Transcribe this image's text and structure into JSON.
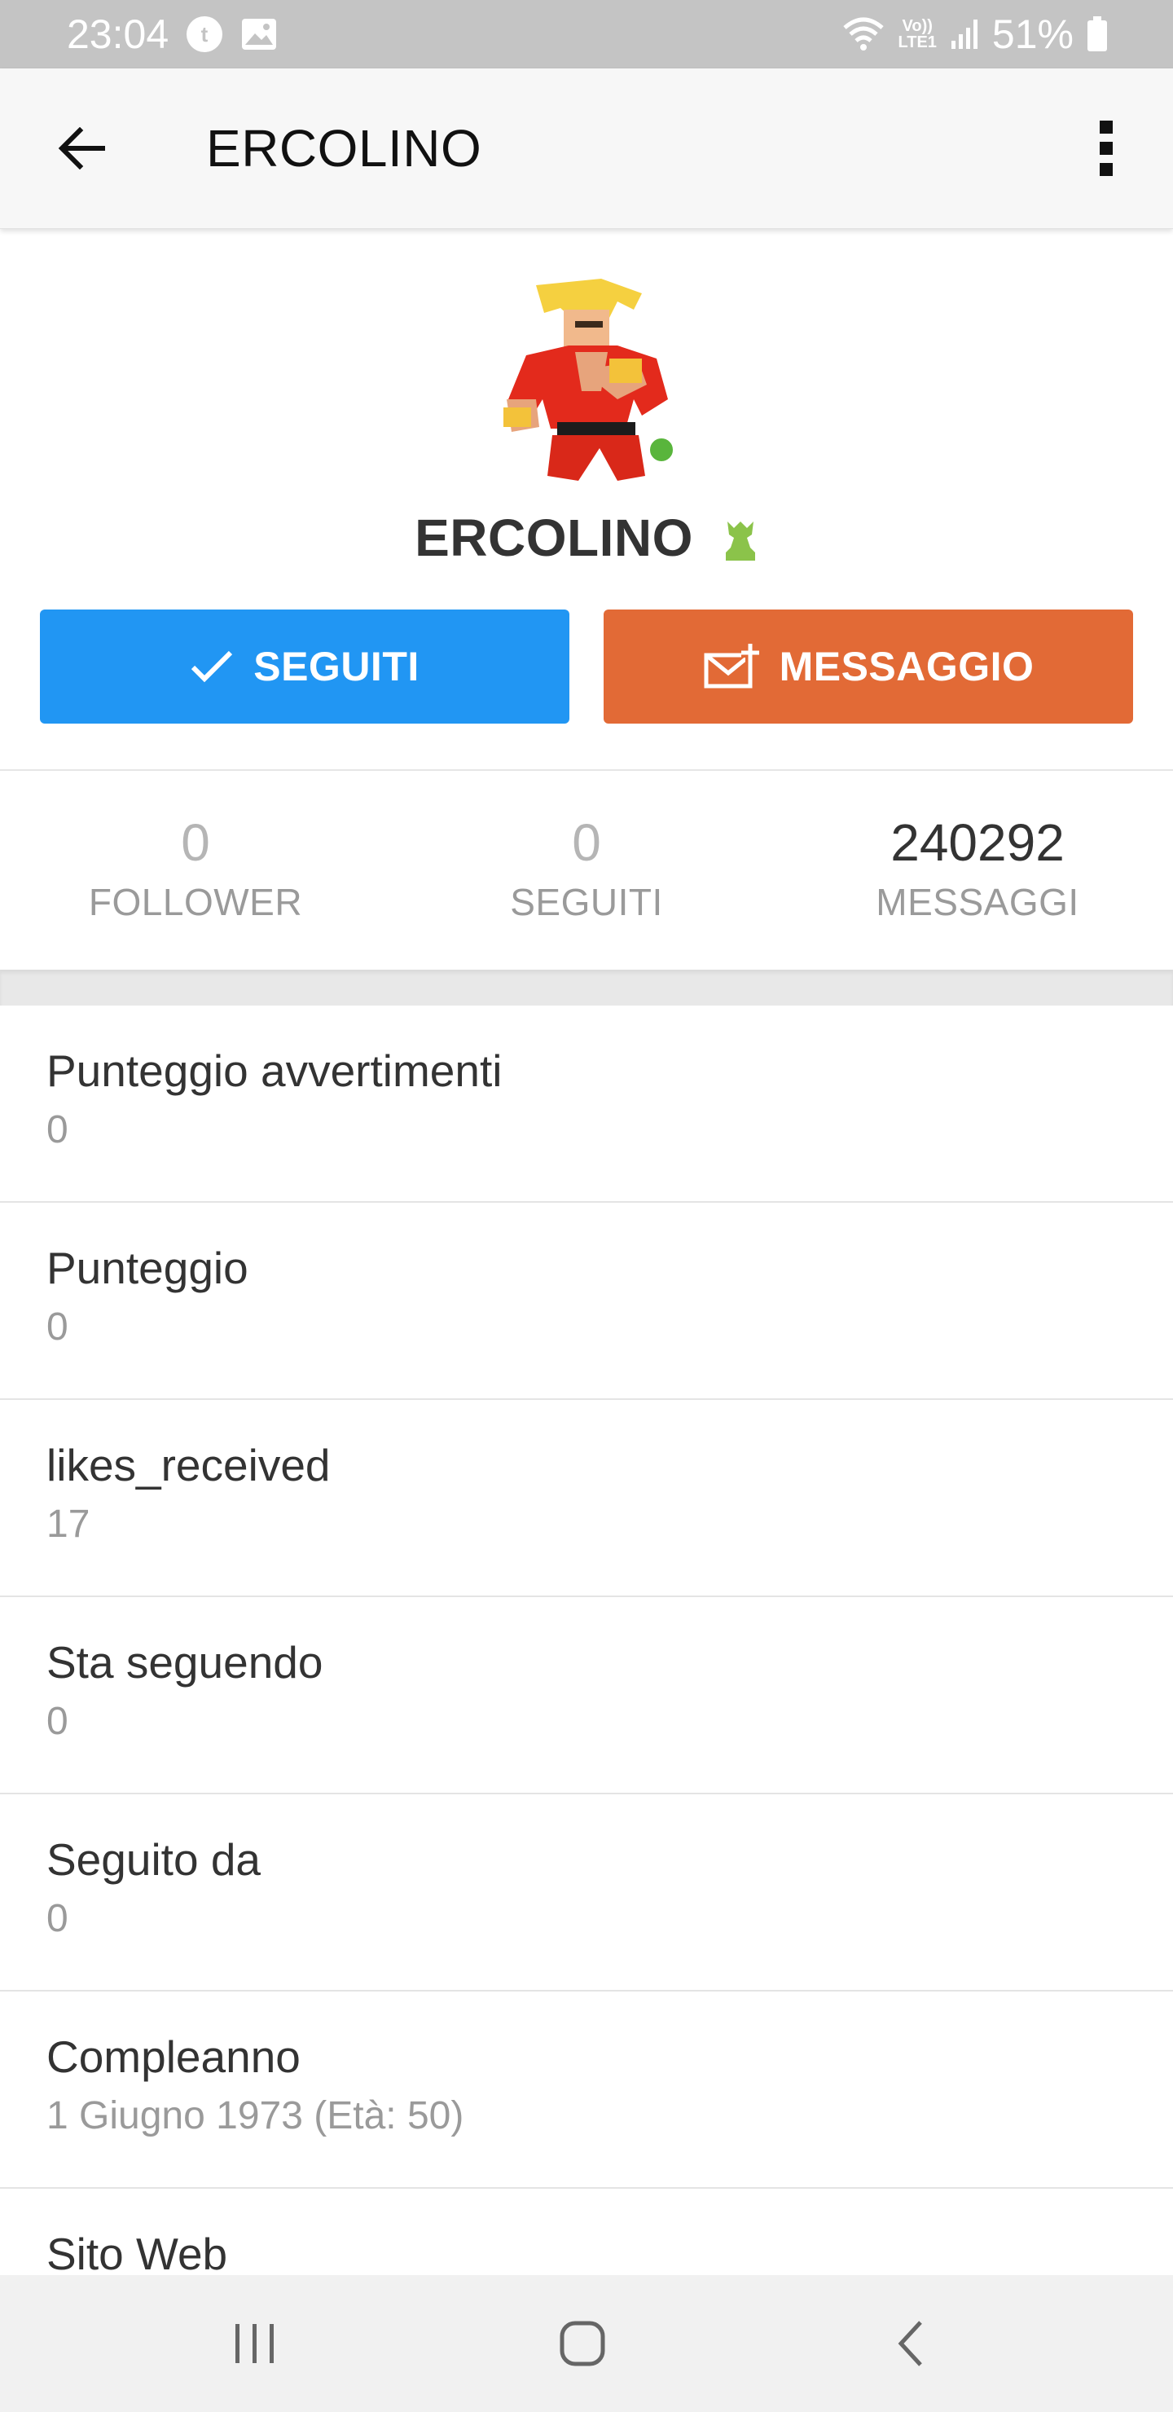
{
  "status_bar": {
    "time": "23:04",
    "network_top": "Vo))",
    "network_bottom": "LTE1",
    "battery_percent": "51%"
  },
  "app_bar": {
    "title": "ERCOLINO"
  },
  "profile": {
    "name": "ERCOLINO",
    "online": true,
    "follow_button_label": "SEGUITI",
    "message_button_label": "MESSAGGIO"
  },
  "stats": [
    {
      "value": "0",
      "label": "FOLLOWER"
    },
    {
      "value": "0",
      "label": "SEGUITI"
    },
    {
      "value": "240292",
      "label": "MESSAGGI"
    }
  ],
  "info": [
    {
      "label": "Punteggio avvertimenti",
      "value": "0"
    },
    {
      "label": "Punteggio",
      "value": "0"
    },
    {
      "label": "likes_received",
      "value": "17"
    },
    {
      "label": "Sta seguendo",
      "value": "0"
    },
    {
      "label": "Seguito da",
      "value": "0"
    },
    {
      "label": "Compleanno",
      "value": "1 Giugno 1973 (Età: 50)"
    },
    {
      "label": "Sito Web",
      "value": ""
    }
  ],
  "colors": {
    "follow_button": "#2196f3",
    "message_button": "#e26a36",
    "online_dot": "#59b53c",
    "rank_icon": "#8bc34a"
  }
}
